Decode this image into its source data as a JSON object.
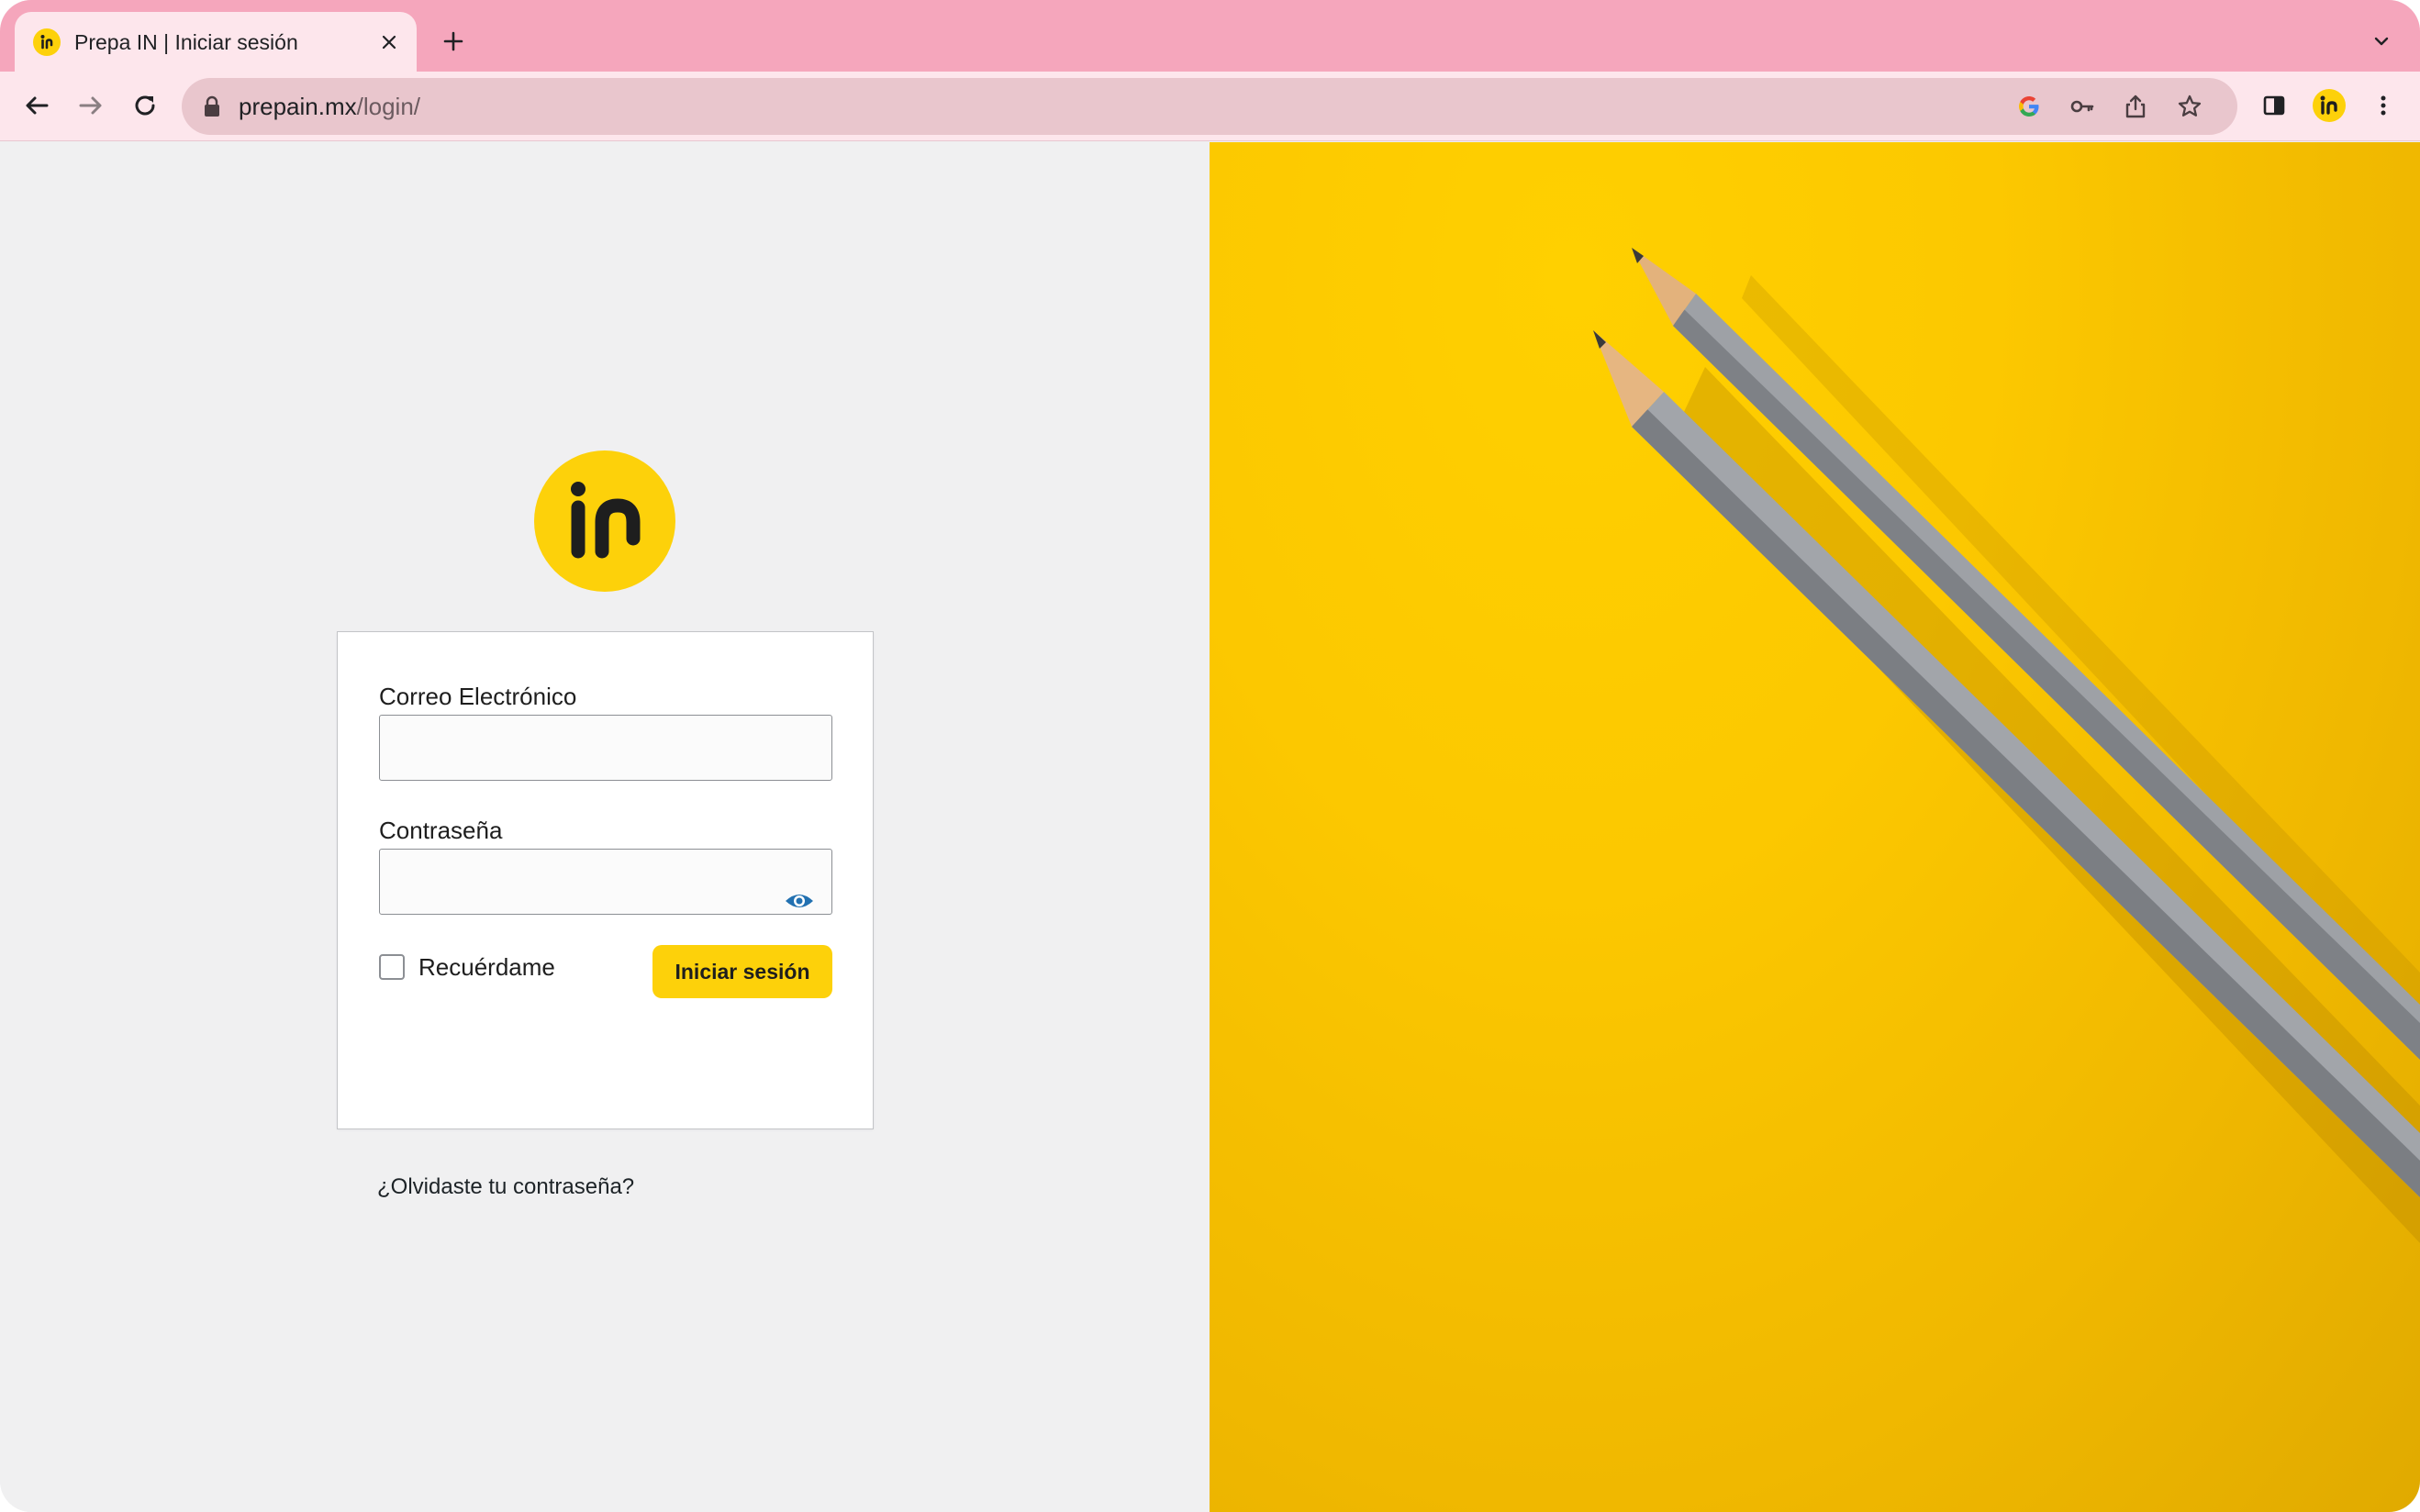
{
  "browser": {
    "tab": {
      "title": "Prepa IN | Iniciar sesión",
      "favicon": "prepa-in-logo"
    },
    "address_bar": {
      "host": "prepain.mx",
      "path": "/login/"
    },
    "icons": {
      "back": "arrow-left-icon",
      "forward": "arrow-right-icon",
      "reload": "reload-icon",
      "lock": "lock-icon",
      "google": "google-icon",
      "password_key": "key-icon",
      "share": "share-icon",
      "bookmark": "star-icon",
      "side_panel": "side-panel-icon",
      "profile": "profile-avatar",
      "menu": "kebab-menu-icon",
      "tab_close": "close-icon",
      "new_tab": "plus-icon",
      "tab_search": "chevron-down-icon"
    },
    "colors": {
      "tabstrip": "#f5a6bc",
      "toolbar": "#fde6ec",
      "omnibox": "#e9c6cd"
    }
  },
  "login": {
    "email_label": "Correo Electrónico",
    "email_value": "",
    "password_label": "Contraseña",
    "password_value": "",
    "show_password_icon": "eye-icon",
    "remember_label": "Recuérdame",
    "remember_checked": false,
    "submit_label": "Iniciar sesión",
    "lost_password_link": "¿Olvidaste tu contraseña?"
  },
  "brand": {
    "accent": "#fdd10a",
    "logo_icon": "prepa-in-logo"
  },
  "hero_image": {
    "subject": "pencils-on-yellow-background"
  }
}
